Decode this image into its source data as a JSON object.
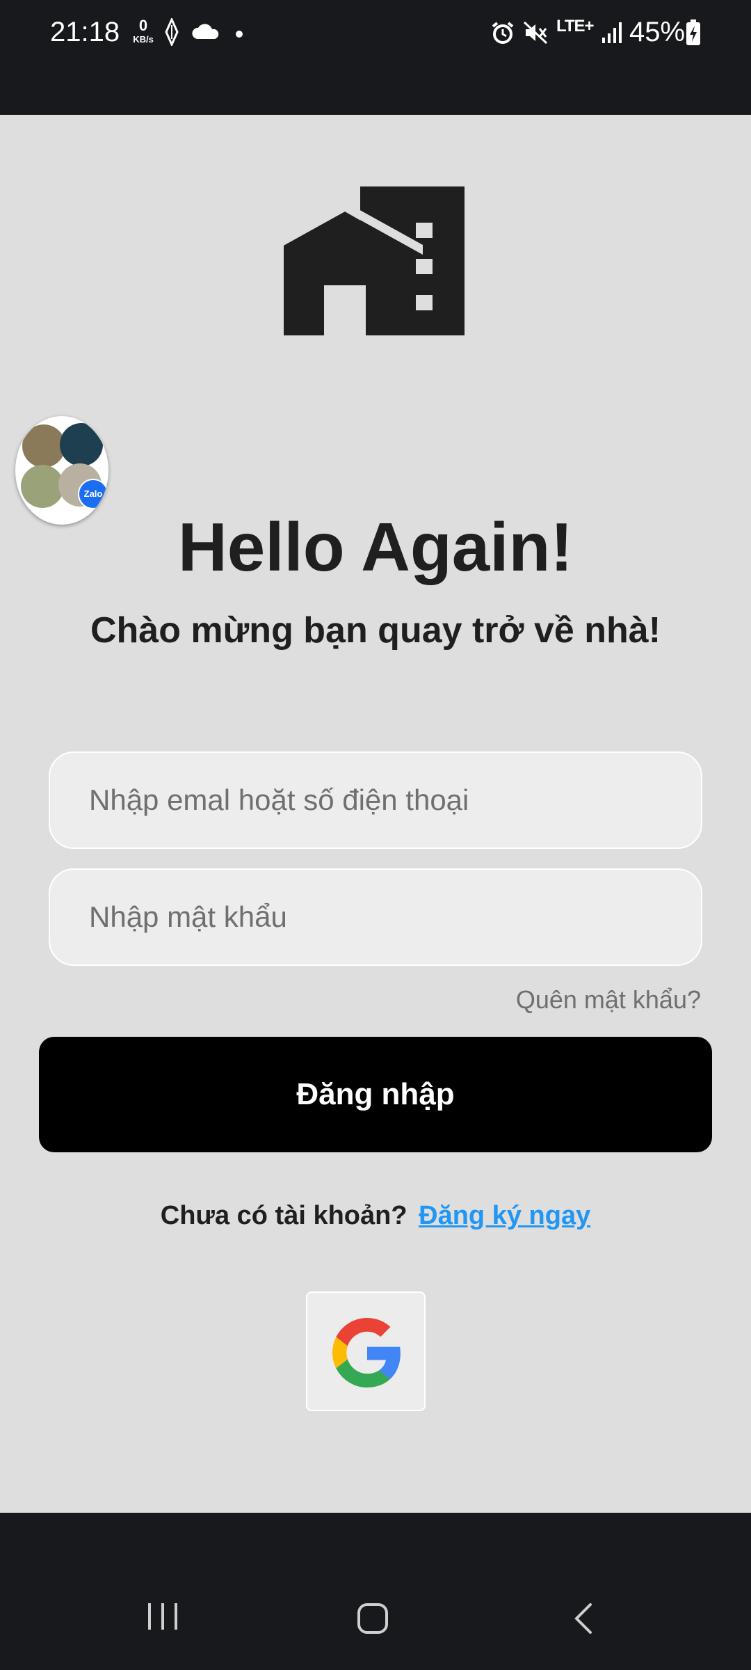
{
  "status_bar": {
    "time": "21:18",
    "net_speed_value": "0",
    "net_speed_unit": "KB/s",
    "network_type": "LTE+",
    "battery_percent": "45%",
    "icons": [
      "vpn-icon",
      "cloud-icon",
      "dot-icon",
      "alarm-icon",
      "mute-icon",
      "signal-icon",
      "battery-charging-icon"
    ]
  },
  "chat_head": {
    "badge": "Zalo"
  },
  "login": {
    "title": "Hello Again!",
    "subtitle": "Chào mừng bạn quay trở về nhà!",
    "email_placeholder": "Nhập emal hoặt số điện thoại",
    "password_placeholder": "Nhập mật khẩu",
    "forgot_password": "Quên mật khẩu?",
    "login_button": "Đăng nhập",
    "no_account_text": "Chưa có tài khoản?",
    "signup_link": "Đăng ký ngay"
  },
  "colors": {
    "background": "#dedede",
    "bars": "#17191c",
    "primary_button": "#000000",
    "link": "#2196f3"
  }
}
